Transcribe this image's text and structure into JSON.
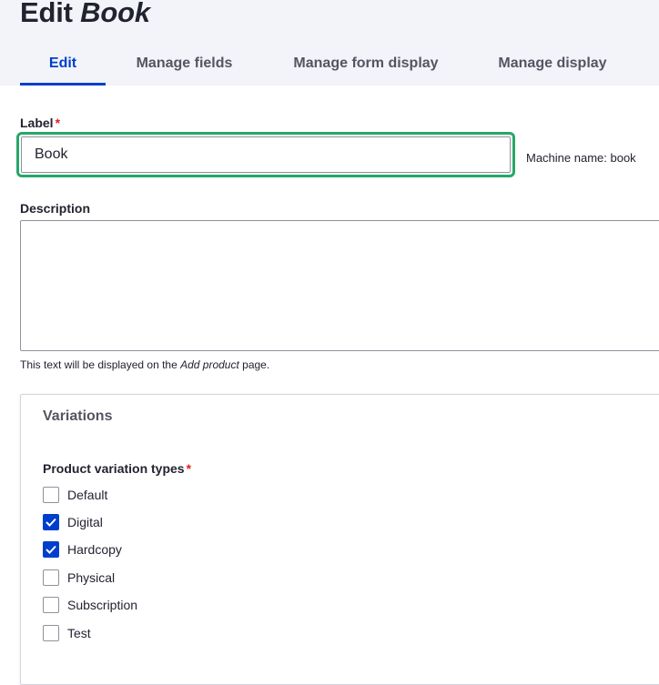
{
  "page": {
    "title_prefix": "Edit",
    "title_entity": "Book"
  },
  "tabs": [
    {
      "label": "Edit",
      "active": true
    },
    {
      "label": "Manage fields",
      "active": false
    },
    {
      "label": "Manage form display",
      "active": false
    },
    {
      "label": "Manage display",
      "active": false
    }
  ],
  "label_field": {
    "label": "Label",
    "required_marker": "*",
    "value": "Book",
    "machine_name": "Machine name: book"
  },
  "description_field": {
    "label": "Description",
    "value": "",
    "help_prefix": "This text will be displayed on the ",
    "help_emphasis": "Add product",
    "help_suffix": " page."
  },
  "variations": {
    "legend": "Variations",
    "types_label": "Product variation types",
    "required_marker": "*",
    "options": [
      {
        "label": "Default",
        "checked": false
      },
      {
        "label": "Digital",
        "checked": true
      },
      {
        "label": "Hardcopy",
        "checked": true
      },
      {
        "label": "Physical",
        "checked": false
      },
      {
        "label": "Subscription",
        "checked": false
      },
      {
        "label": "Test",
        "checked": false
      }
    ]
  },
  "colors": {
    "accent": "#003ecc",
    "focus_ring": "#26a769",
    "required": "#dc2323"
  }
}
